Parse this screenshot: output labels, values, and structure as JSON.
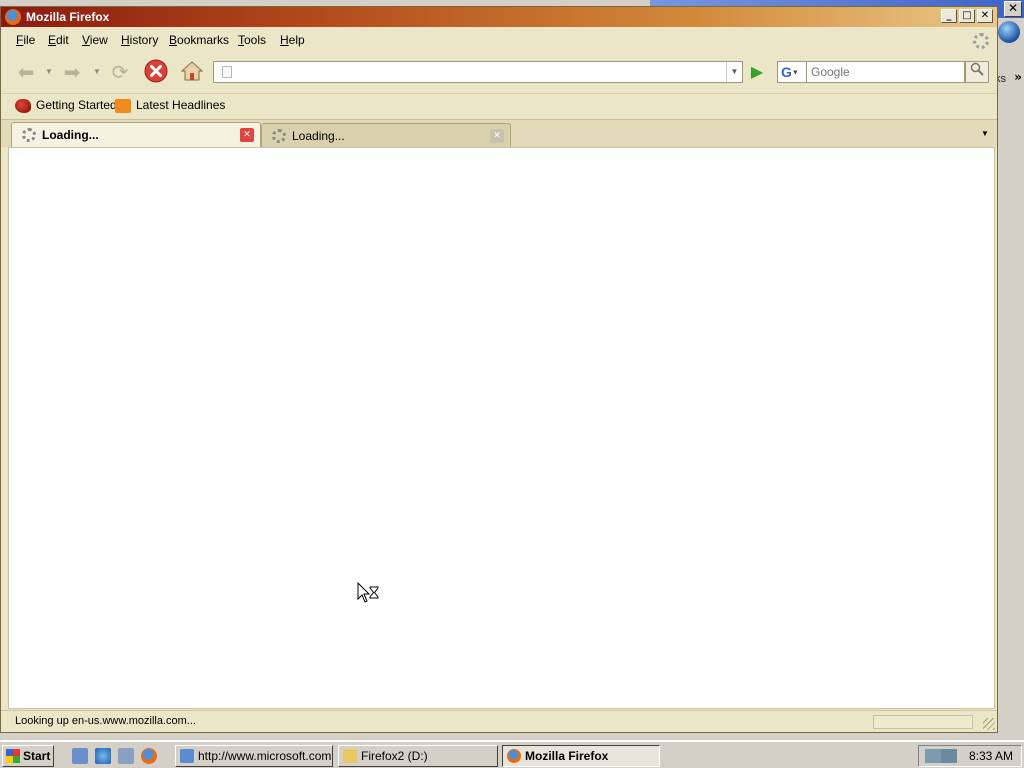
{
  "firefox": {
    "title": "Mozilla Firefox",
    "menu": [
      "File",
      "Edit",
      "View",
      "History",
      "Bookmarks",
      "Tools",
      "Help"
    ],
    "menu_underline": [
      "F",
      "E",
      "V",
      "H",
      "B",
      "T",
      "H"
    ],
    "url": "",
    "search_placeholder": "Google",
    "bookmarks": [
      "Getting Started",
      "Latest Headlines"
    ],
    "tabs": [
      {
        "label": "Loading...",
        "active": true
      },
      {
        "label": "Loading...",
        "active": false
      }
    ],
    "status": "Looking up en-us.www.mozilla.com..."
  },
  "background_window": {
    "overflow_text": "ks",
    "chevron": "»"
  },
  "taskbar": {
    "start_label": "Start",
    "tasks": [
      {
        "label": "http://www.microsoft.com...",
        "icon": "ie-page-icon",
        "pressed": false
      },
      {
        "label": "Firefox2 (D:)",
        "icon": "folder-icon",
        "pressed": false
      },
      {
        "label": "Mozilla Firefox",
        "icon": "firefox-icon",
        "pressed": true
      }
    ],
    "quick_launch": [
      "show-desktop-icon",
      "ie-icon",
      "network-icon",
      "firefox-icon"
    ],
    "tray_icons": [
      "network-connection-icon",
      "network-connection-icon-2"
    ],
    "clock": "8:33 AM"
  },
  "colors": {
    "firefox_chrome": "#ece6c8",
    "titlebar_start": "#8a1a10",
    "titlebar_end": "#e9c98a",
    "taskbar": "#d4d0c8"
  }
}
